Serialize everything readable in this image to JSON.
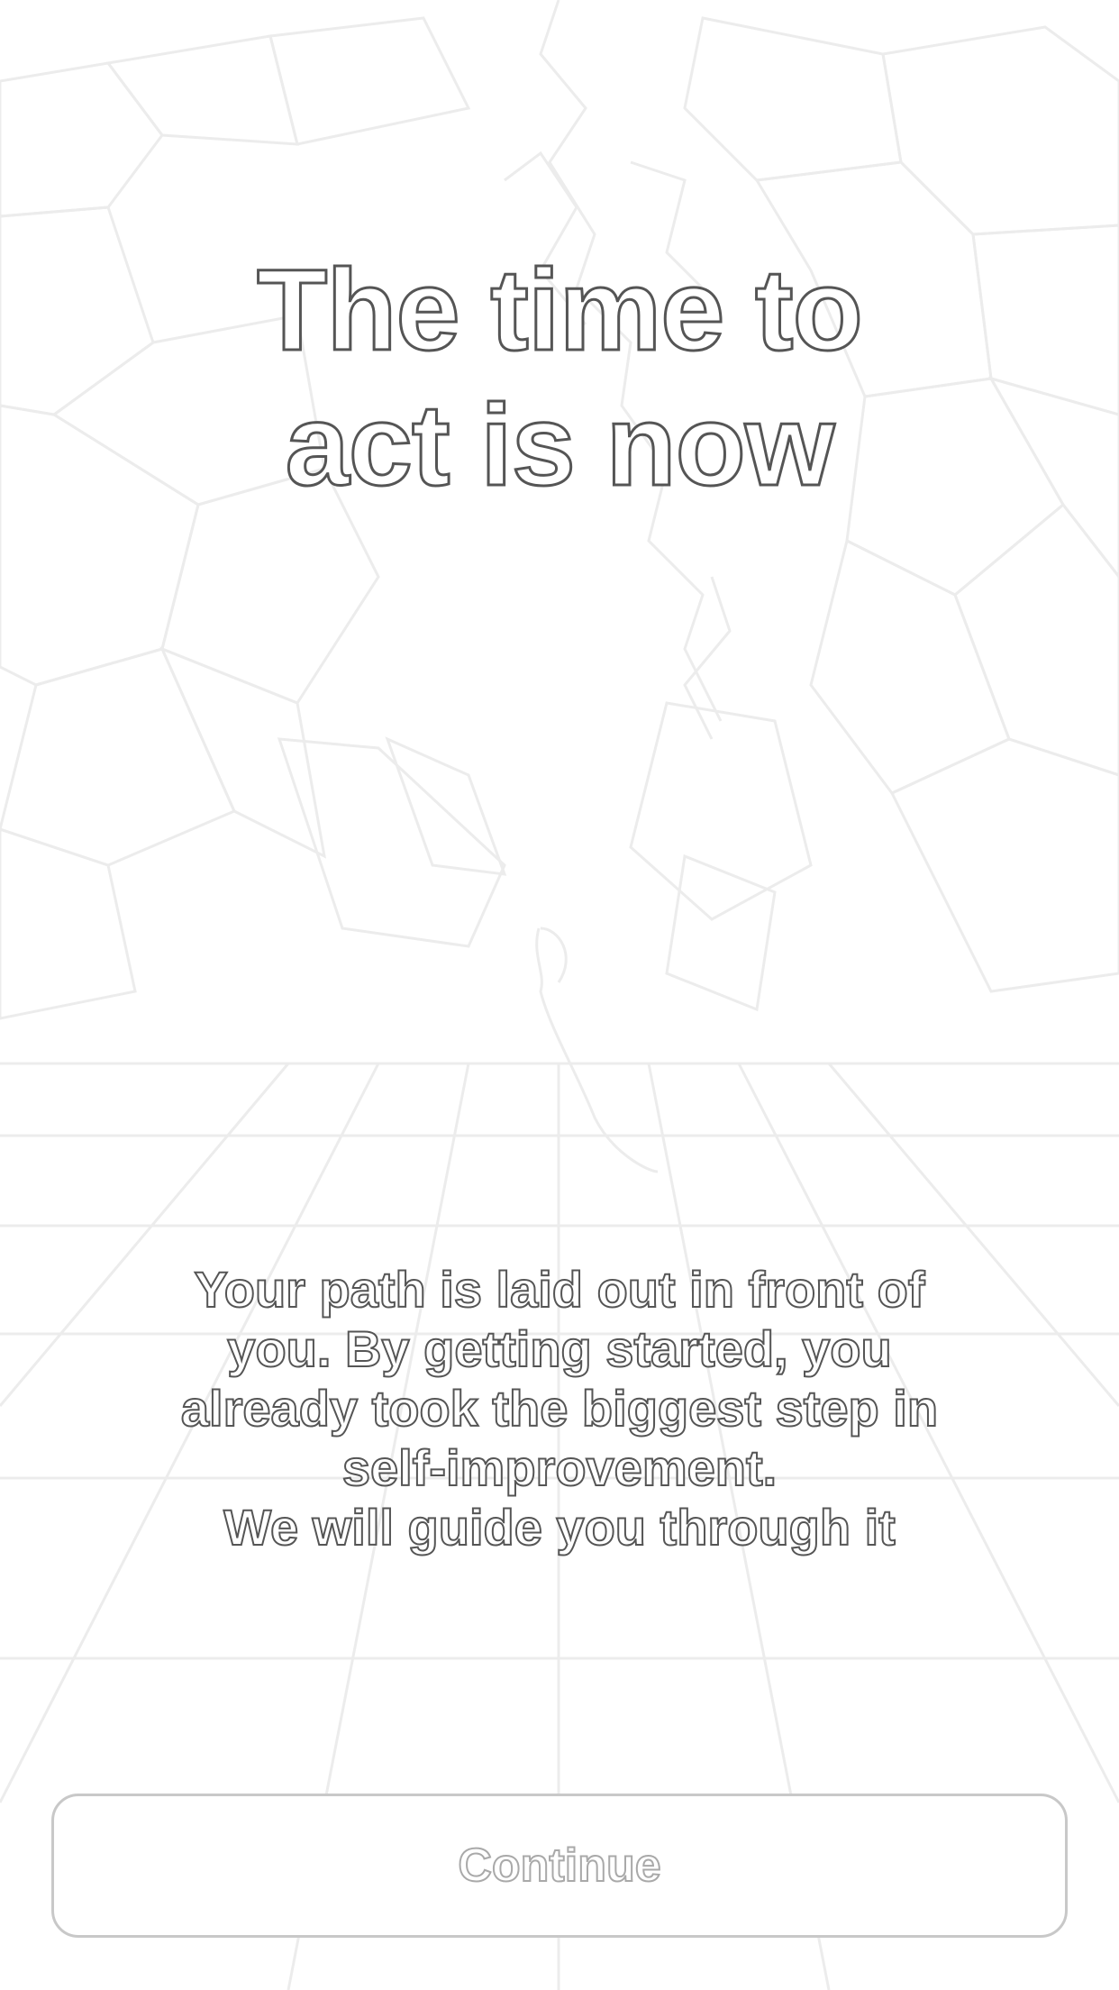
{
  "headline": {
    "line1": "The time to",
    "line2": "act is now"
  },
  "description": {
    "line1": "Your path is laid out in front of",
    "line2": "you. By getting started, you",
    "line3": "already took the biggest step in",
    "line4": "self-improvement.",
    "line5": "We will guide you through it"
  },
  "continue_button": {
    "label": "Continue"
  },
  "background": {
    "icon": "mountain-climber-illustration"
  }
}
